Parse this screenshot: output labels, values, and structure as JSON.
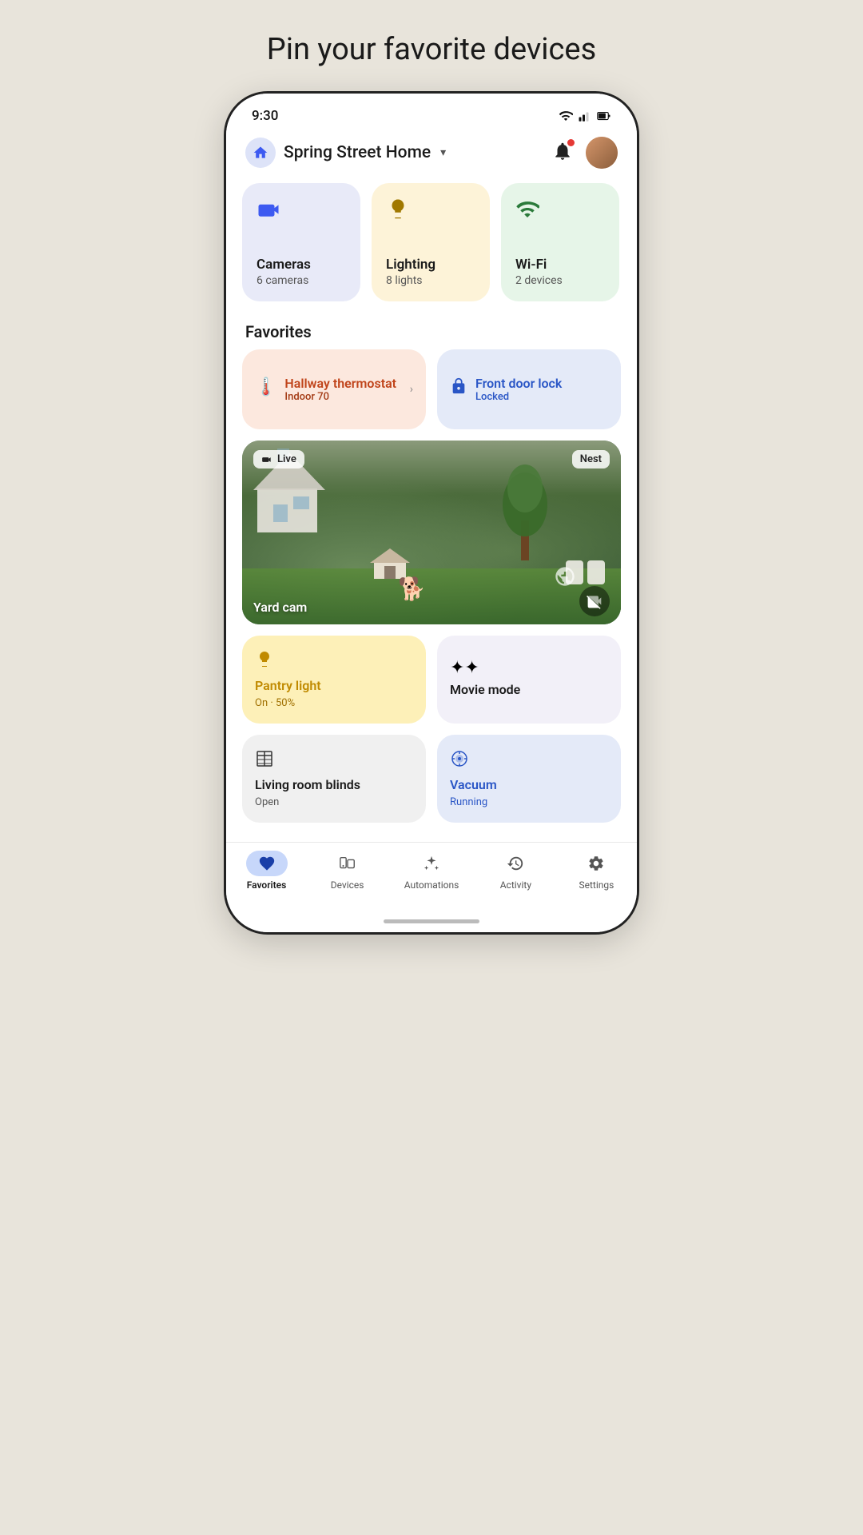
{
  "page": {
    "title": "Pin your favorite devices"
  },
  "statusBar": {
    "time": "9:30"
  },
  "header": {
    "homeName": "Spring Street Home",
    "chevron": "▾"
  },
  "categories": [
    {
      "id": "cameras",
      "icon": "📹",
      "name": "Cameras",
      "count": "6 cameras",
      "color": "cat-cameras"
    },
    {
      "id": "lighting",
      "icon": "💡",
      "name": "Lighting",
      "count": "8 lights",
      "color": "cat-lighting"
    },
    {
      "id": "wifi",
      "icon": "wifi",
      "name": "Wi-Fi",
      "count": "2 devices",
      "color": "cat-wifi"
    }
  ],
  "favoritesLabel": "Favorites",
  "favorites": [
    {
      "id": "hallway-thermostat",
      "name": "Hallway thermostat",
      "status": "Indoor 70",
      "type": "thermostat"
    },
    {
      "id": "front-door-lock",
      "name": "Front door lock",
      "status": "Locked",
      "type": "lock"
    }
  ],
  "camera": {
    "liveBadge": "Live",
    "nestBadge": "Nest",
    "name": "Yard cam"
  },
  "moreFavorites": [
    {
      "id": "pantry-light",
      "name": "Pantry light",
      "status": "On · 50%",
      "type": "pantry"
    },
    {
      "id": "movie-mode",
      "name": "Movie mode",
      "status": "",
      "type": "movie"
    },
    {
      "id": "living-room-blinds",
      "name": "Living room blinds",
      "status": "Open",
      "type": "blinds"
    },
    {
      "id": "vacuum",
      "name": "Vacuum",
      "status": "Running",
      "type": "vacuum"
    }
  ],
  "nav": {
    "items": [
      {
        "id": "favorites",
        "label": "Favorites",
        "icon": "♥",
        "active": true
      },
      {
        "id": "devices",
        "label": "Devices",
        "active": false
      },
      {
        "id": "automations",
        "label": "Automations",
        "active": false
      },
      {
        "id": "activity",
        "label": "Activity",
        "active": false
      },
      {
        "id": "settings",
        "label": "Settings",
        "active": false
      }
    ]
  }
}
